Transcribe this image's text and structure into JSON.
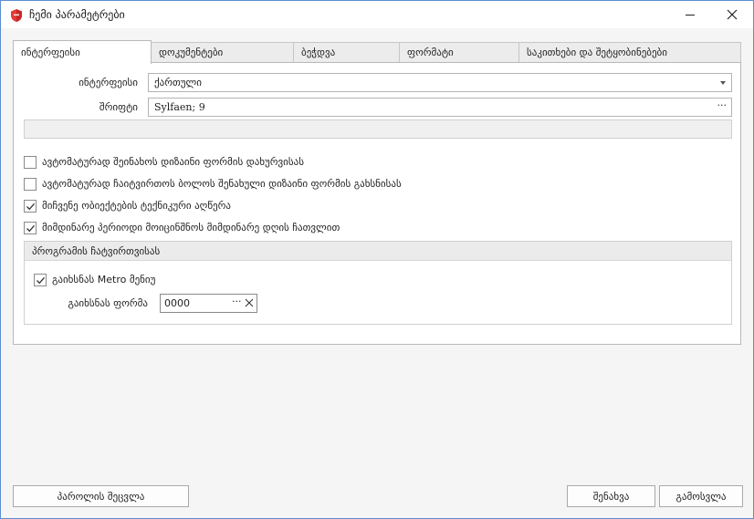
{
  "window": {
    "title": "ჩემი პარამეტრები"
  },
  "tabs": [
    {
      "label": "ინტერფეისი",
      "active": true
    },
    {
      "label": "დოკუმენტები",
      "active": false
    },
    {
      "label": "ბეჭდვა",
      "active": false
    },
    {
      "label": "ფორმატი",
      "active": false
    },
    {
      "label": "საკითხები და შეტყობინებები",
      "active": false
    }
  ],
  "interface": {
    "interface_label": "ინტერფეისი",
    "interface_value": "ქართული",
    "font_label": "შრიფტი",
    "font_value": "Sylfaen; 9",
    "ellipsis": "···"
  },
  "options": [
    {
      "label": "ავტომატურად შეინახოს დიზაინი ფორმის დახურვისას",
      "checked": false
    },
    {
      "label": "ავტომატურად ჩაიტვირთოს ბოლოს შენახული დიზაინი ფორმის გახსნისას",
      "checked": false
    },
    {
      "label": "მიჩვენე ობიექტების ტექნიკური აღწერა",
      "checked": true
    },
    {
      "label": "მიმდინარე პერიოდი მოიცინშნოს მიმდინარე დღის ჩათვლით",
      "checked": true
    }
  ],
  "startup_group": {
    "title": "პროგრამის ჩატვირთვისას",
    "metro_label": "გაიხსნას Metro მენიუ",
    "metro_checked": true,
    "form_label": "გაიხსნას ფორმა",
    "form_value": "0000",
    "ellipsis": "···"
  },
  "buttons": {
    "change_password": "პაროლის შეცვლა",
    "save": "შენახვა",
    "exit": "გამოსვლა"
  },
  "colors": {
    "accent": "#5a8fd0",
    "app_icon": "#e53935"
  }
}
